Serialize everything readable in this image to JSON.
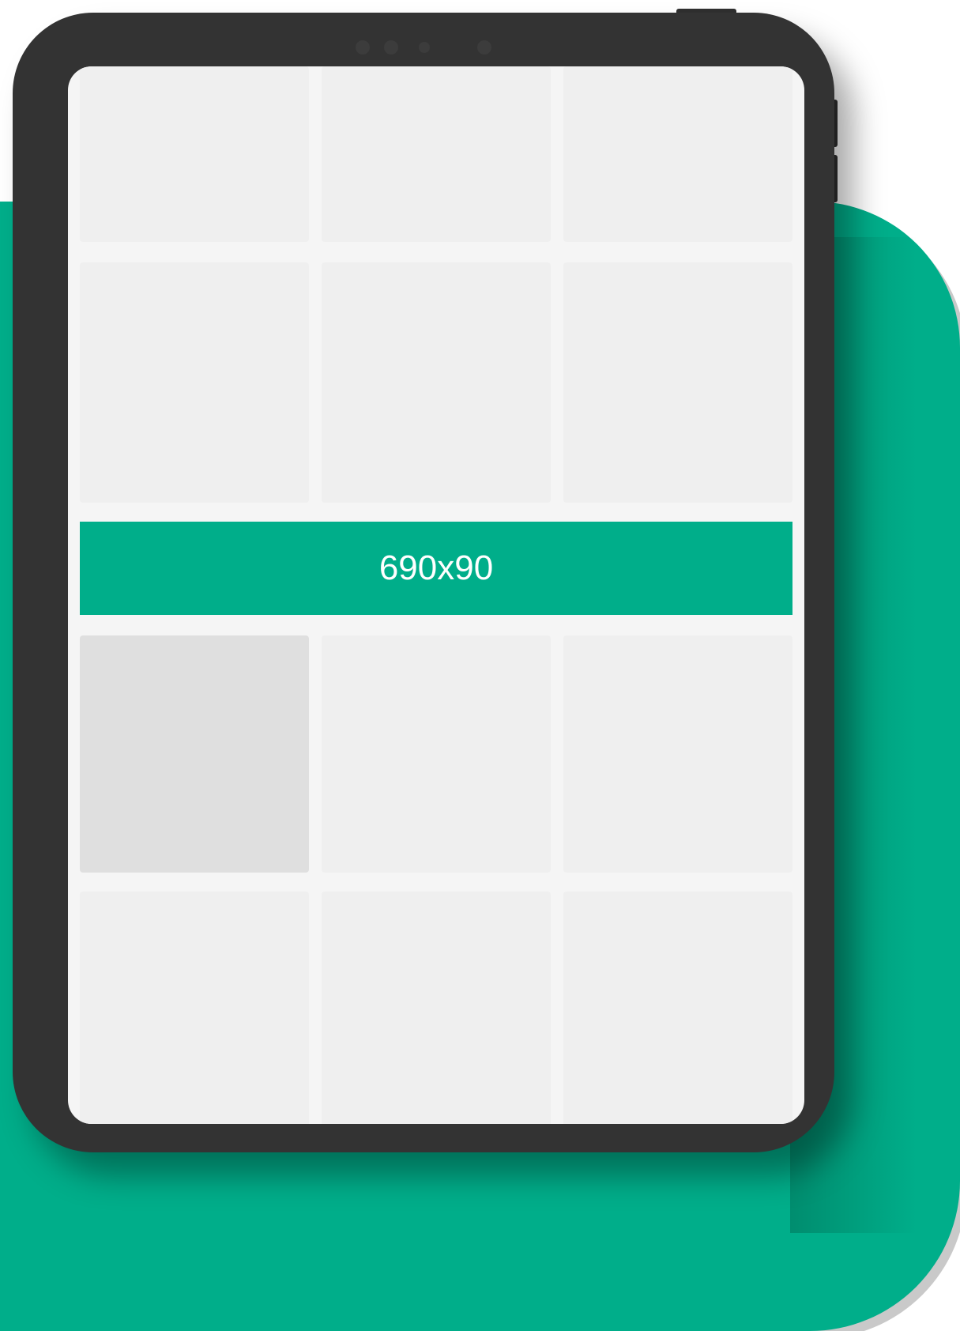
{
  "colors": {
    "accent": "#00ae8a",
    "device_frame": "#333333",
    "screen_background": "#f5f5f5",
    "tile": "#efefef",
    "tile_selected": "#dfdfdf"
  },
  "ad_banner": {
    "label": "690x90"
  }
}
